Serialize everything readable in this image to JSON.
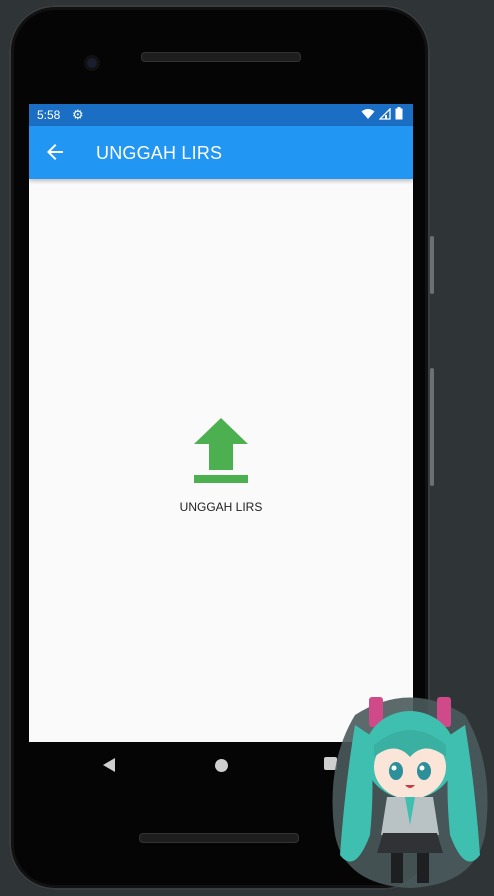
{
  "statusbar": {
    "time": "5:58"
  },
  "appbar": {
    "title": "UNGGAH LIRS"
  },
  "main": {
    "upload_label": "UNGGAH LIRS"
  },
  "colors": {
    "appbar": "#2196f3",
    "statusbar": "#1a6fc4",
    "upload_icon": "#4caf50"
  },
  "icons": [
    "settings-gear-icon",
    "wifi-icon",
    "signal-icon",
    "battery-icon",
    "back-arrow-icon",
    "upload-icon",
    "nav-back-icon",
    "nav-home-icon",
    "nav-recent-icon"
  ]
}
